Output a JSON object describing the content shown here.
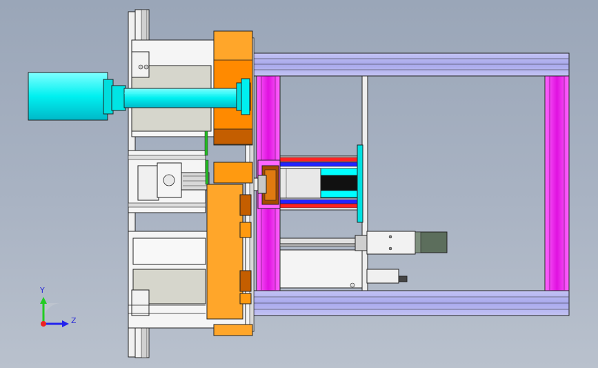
{
  "view": {
    "background_color": "#a4afbf"
  },
  "colors": {
    "frame_blue": "#aaaaee",
    "frame_magenta": "#ee22ee",
    "motor_cyan": "#00ffff",
    "orange": "#ffa500",
    "dark_orange": "#cc6600",
    "plate_white": "#f2f2f2",
    "plate_gray": "#d9d9d0",
    "red_rail": "#ff2020",
    "blue_rail": "#2020ff",
    "cylinder_gray": "#5a6b5a",
    "line": "#222222"
  },
  "triad": {
    "y_label": "Y",
    "z_label": "Z",
    "y_color": "#22cc22",
    "z_color": "#2222ee",
    "origin_color": "#ee2222"
  }
}
